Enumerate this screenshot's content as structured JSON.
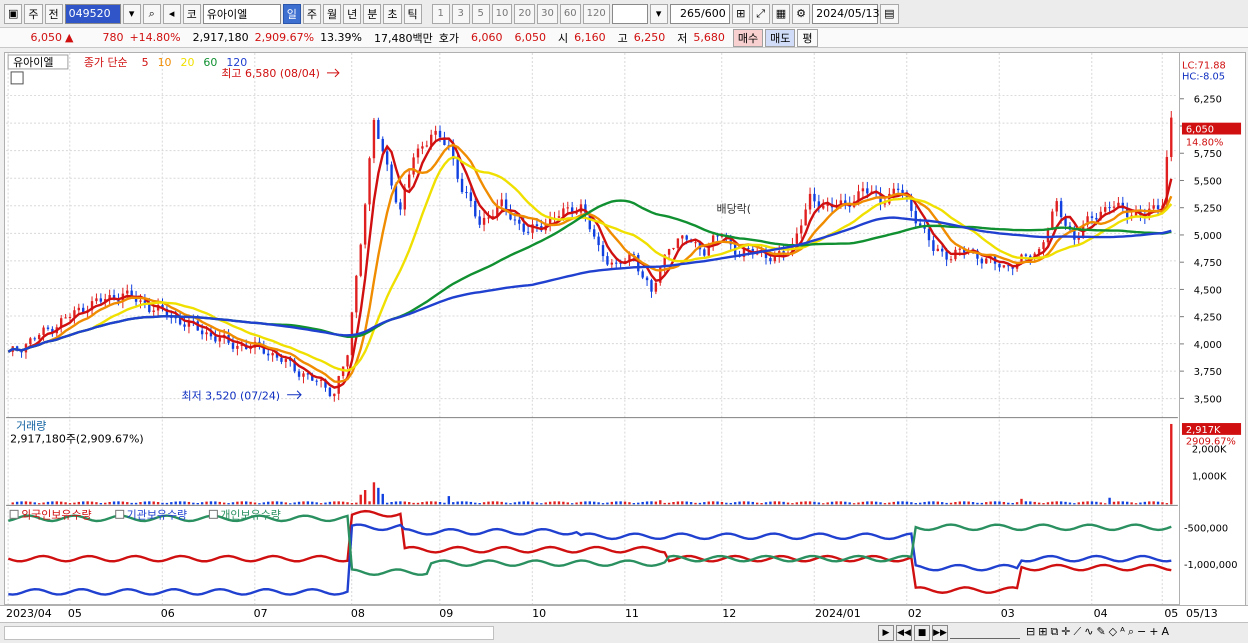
{
  "toolbar": {
    "week_label": "주",
    "prev_label": "전",
    "stock_code": "049520",
    "market_label": "코",
    "stock_name": "유아이엘",
    "period_tabs": [
      "일",
      "주",
      "월",
      "년",
      "분",
      "초",
      "틱"
    ],
    "active_period": "일",
    "intervals": [
      "1",
      "3",
      "5",
      "10",
      "20",
      "30",
      "60",
      "120"
    ],
    "count_value": "265",
    "count_max": "/600",
    "date_value": "2024/05/13"
  },
  "quote": {
    "price": "6,050",
    "up_symbol": "▲",
    "change": "780",
    "change_pct": "+14.80%",
    "volume": "2,917,180",
    "volume_pct": "2,909.67%",
    "turnover_pct": "13.39%",
    "amount": "17,480백만",
    "bid_label": "호가",
    "bid1": "6,060",
    "bid2": "6,050",
    "open_label": "시",
    "open": "6,160",
    "high_label": "고",
    "high": "6,250",
    "low_label": "저",
    "low": "5,680",
    "buy_label": "매수",
    "sell_label": "매도",
    "eval_label": "평"
  },
  "price_panel": {
    "stock_tag": "유아이엘",
    "ma_title": "종가 단순",
    "ma_periods": [
      "5",
      "10",
      "20",
      "60",
      "120"
    ],
    "ma_colors": [
      "#d01010",
      "#f08c00",
      "#f0e000",
      "#109030",
      "#2040d0"
    ],
    "lc_label": "LC:71.88",
    "hc_label": "HC:-8.05",
    "high_marker": "최고 6,580 (08/04)",
    "low_marker": "최저 3,520 (07/24)",
    "dividend_marker": "배당락(",
    "last_price_tag": "6,050",
    "last_pct_tag": "14.80%",
    "y_ticks": [
      "6,250",
      "6,000",
      "5,750",
      "5,500",
      "5,250",
      "5,000",
      "4,750",
      "4,500",
      "4,250",
      "4,000",
      "3,750",
      "3,500"
    ]
  },
  "volume_panel": {
    "title": "거래량",
    "value": "2,917,180주(2,909.67%)",
    "tag_value": "2,917K",
    "tag_pct": "2909.67%",
    "y_ticks": [
      "2,000K",
      "1,000K"
    ]
  },
  "holding_panel": {
    "legend": [
      {
        "label": "외국인보유수량",
        "color": "#d01010"
      },
      {
        "label": "기관보유수량",
        "color": "#2040d0"
      },
      {
        "label": "개인보유수량",
        "color": "#2a9060"
      }
    ],
    "y_ticks": [
      "-500,000",
      "-1,000,000"
    ]
  },
  "x_axis": {
    "labels": [
      "2023/04",
      "05",
      "06",
      "07",
      "08",
      "09",
      "10",
      "11",
      "12",
      "2024/01",
      "02",
      "03",
      "04",
      "05"
    ],
    "right_label": "05/13"
  },
  "chart_data": {
    "type": "candlestick",
    "price_range": [
      3400,
      6600
    ],
    "price_points": [
      [
        0,
        3900
      ],
      [
        8,
        4100
      ],
      [
        18,
        4350
      ],
      [
        26,
        4450
      ],
      [
        34,
        4300
      ],
      [
        42,
        4150
      ],
      [
        50,
        4000
      ],
      [
        58,
        3950
      ],
      [
        64,
        3800
      ],
      [
        70,
        3650
      ],
      [
        74,
        3560
      ],
      [
        77,
        3900
      ],
      [
        80,
        4950
      ],
      [
        83,
        6000
      ],
      [
        86,
        5600
      ],
      [
        89,
        5200
      ],
      [
        92,
        5700
      ],
      [
        96,
        5900
      ],
      [
        100,
        5800
      ],
      [
        103,
        5400
      ],
      [
        107,
        5100
      ],
      [
        112,
        5250
      ],
      [
        118,
        5000
      ],
      [
        124,
        5150
      ],
      [
        130,
        5250
      ],
      [
        134,
        4850
      ],
      [
        138,
        4700
      ],
      [
        142,
        4800
      ],
      [
        146,
        4450
      ],
      [
        150,
        4900
      ],
      [
        154,
        4950
      ],
      [
        158,
        4850
      ],
      [
        162,
        5000
      ],
      [
        166,
        4800
      ],
      [
        170,
        4850
      ],
      [
        174,
        4750
      ],
      [
        178,
        4900
      ],
      [
        182,
        5300
      ],
      [
        186,
        5250
      ],
      [
        190,
        5250
      ],
      [
        194,
        5400
      ],
      [
        198,
        5300
      ],
      [
        202,
        5400
      ],
      [
        206,
        5150
      ],
      [
        210,
        4850
      ],
      [
        214,
        4800
      ],
      [
        218,
        4850
      ],
      [
        222,
        4750
      ],
      [
        226,
        4700
      ],
      [
        230,
        4750
      ],
      [
        234,
        4850
      ],
      [
        238,
        5250
      ],
      [
        242,
        4950
      ],
      [
        246,
        5150
      ],
      [
        250,
        5250
      ],
      [
        254,
        5200
      ],
      [
        258,
        5150
      ],
      [
        262,
        5300
      ],
      [
        264,
        6050
      ]
    ],
    "volume_spikes": [
      [
        80,
        350
      ],
      [
        81,
        520
      ],
      [
        83,
        800
      ],
      [
        84,
        600
      ],
      [
        85,
        380
      ],
      [
        100,
        300
      ],
      [
        148,
        150
      ],
      [
        230,
        200
      ],
      [
        250,
        240
      ],
      [
        264,
        2917
      ]
    ],
    "volume_max": 3000
  }
}
